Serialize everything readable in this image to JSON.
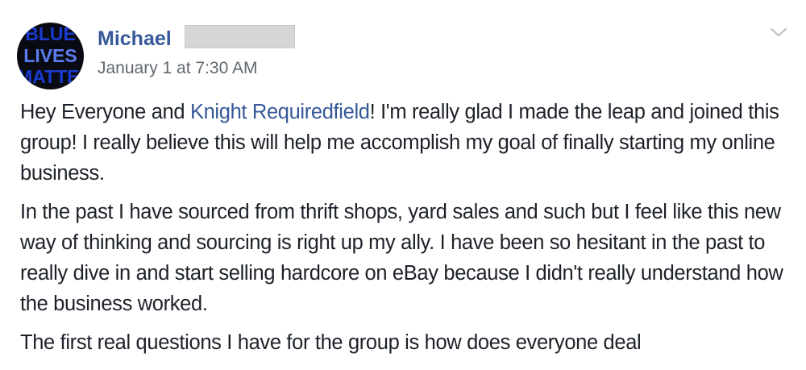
{
  "post": {
    "author": {
      "name": "Michael",
      "avatar_text": [
        "BLUE",
        "LIVES",
        "MATTER"
      ]
    },
    "timestamp": "January 1 at 7:30 AM",
    "options_icon": "chevron-down-icon",
    "paragraphs": [
      {
        "before": "Hey Everyone and ",
        "mention": "Knight Requiredfield",
        "after": "! I'm really glad I made the leap and joined this group! I really believe this will help me accomplish my goal of finally starting my online business."
      },
      {
        "text": "In the past I have sourced from thrift shops, yard sales and such but I feel like this new way of thinking and sourcing is right up my ally. I have been so hesitant in the past to really dive in and start selling hardcore on eBay because I didn't really understand how the business worked."
      },
      {
        "text": "The first real questions I have for the group is how does everyone deal"
      }
    ]
  },
  "colors": {
    "link": "#365899",
    "text": "#1d2129",
    "meta": "#616770",
    "redaction": "#d6d6d6"
  }
}
